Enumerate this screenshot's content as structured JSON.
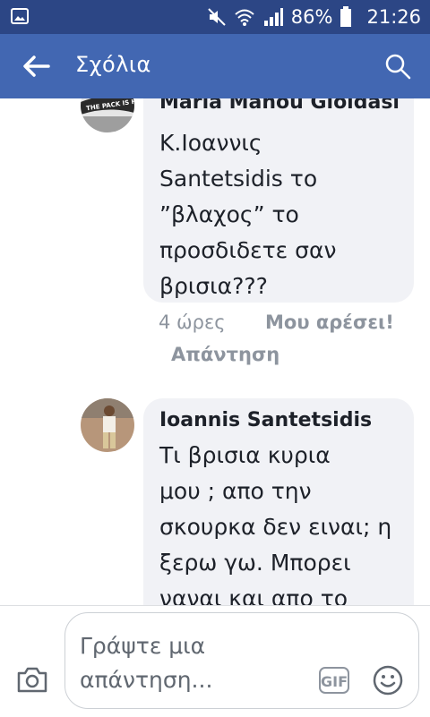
{
  "status_bar": {
    "battery_percent": "86%",
    "time": "21:26"
  },
  "app_bar": {
    "title": "Σχόλια"
  },
  "comments": [
    {
      "author": "Maria Manou Gioldasi",
      "lines": [
        "Κ.Ιοαννις",
        "Santetsidis το",
        "”βλαχος” το",
        "προσδιδετε σαν",
        "βρισια???"
      ],
      "time": "4 ώρες",
      "like_label": "Μου αρέσει!",
      "reply_label": "Απάντηση"
    },
    {
      "author": "Ioannis Santetsidis",
      "lines": [
        "Τι βρισια κυρια",
        "μου ; απο την",
        "σκουρκα δεν ειναι; η",
        "ξερω γω. Μπορει",
        "ναναι και απο το"
      ]
    }
  ],
  "composer": {
    "placeholder": "Γράψτε μια απάντηση...",
    "gif_label": "GIF"
  },
  "icons": {
    "status_left": "image-icon",
    "status": [
      "mute-icon",
      "wifi-icon",
      "signal-icon",
      "battery-icon"
    ],
    "back": "arrow-left-icon",
    "search": "search-icon",
    "camera": "camera-icon",
    "emoji": "smiley-icon"
  },
  "colors": {
    "app_bar": "#4267b2",
    "status_bar": "#2c4685",
    "bubble": "#f1f2f6"
  }
}
